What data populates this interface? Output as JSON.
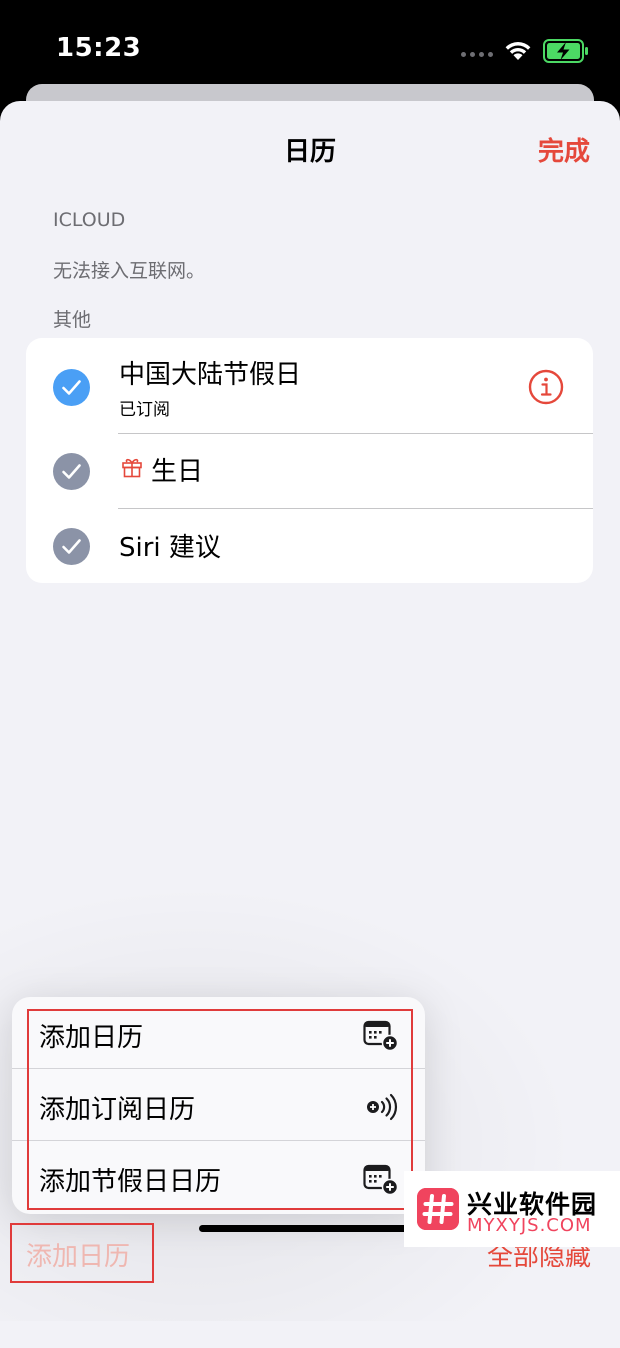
{
  "status_bar": {
    "time": "15:23"
  },
  "header": {
    "title": "日历",
    "done_label": "完成"
  },
  "sections": {
    "icloud_header": "ICLOUD",
    "icloud_note": "无法接入互联网。",
    "other_header": "其他"
  },
  "calendars": [
    {
      "name": "中国大陆节假日",
      "subtitle": "已订阅",
      "checked": true,
      "color": "#4a9ff5"
    },
    {
      "name": "生日",
      "checked": true,
      "color": "#8b93a7"
    },
    {
      "name": "Siri 建议",
      "checked": true,
      "color": "#8b93a7"
    }
  ],
  "popup_menu": {
    "items": [
      {
        "label": "添加日历",
        "icon": "calendar-add-icon"
      },
      {
        "label": "添加订阅日历",
        "icon": "subscribe-broadcast-icon"
      },
      {
        "label": "添加节假日日历",
        "icon": "calendar-add-icon"
      }
    ]
  },
  "toolbar": {
    "add_calendar_label": "添加日历",
    "hide_all_label": "全部隐藏"
  },
  "watermark": {
    "title": "兴业软件园",
    "subtitle": "MYXYJS.COM"
  },
  "colors": {
    "accent": "#e5483b",
    "accent_faded": "#efb7b1",
    "highlight": "#e03b3b"
  }
}
